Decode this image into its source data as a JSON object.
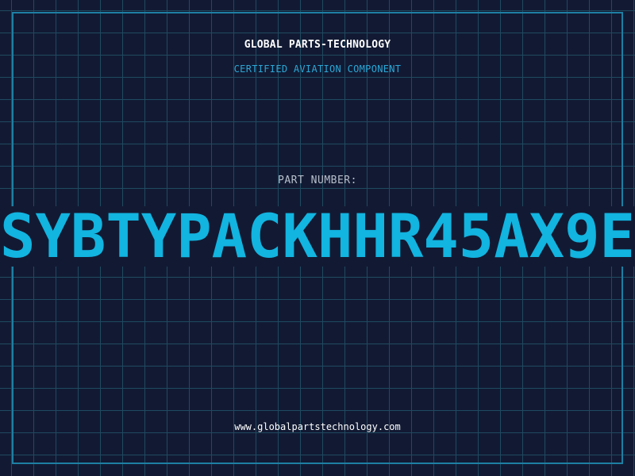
{
  "brand": {
    "title": "GLOBAL PARTS-TECHNOLOGY",
    "subtitle": "CERTIFIED AVIATION COMPONENT"
  },
  "part": {
    "label": "PART NUMBER:",
    "number": "SYBTYPACKHHR45AX9E"
  },
  "footer": {
    "website": "www.globalpartstechnology.com"
  },
  "colors": {
    "background": "#121a33",
    "grid": "#1f4a60",
    "frame": "#1e7fa3",
    "accent": "#12b4e0"
  }
}
